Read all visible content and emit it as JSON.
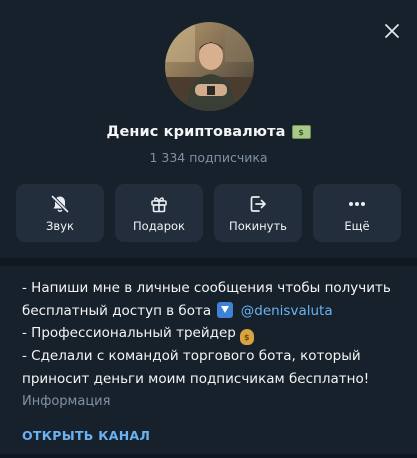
{
  "channel": {
    "title": "Денис криптовалюта",
    "title_emoji": "money-banknote-emoji",
    "subscribers": "1 334 подписчика"
  },
  "actions": [
    {
      "label": "Звук",
      "icon": "bell-muted-icon"
    },
    {
      "label": "Подарок",
      "icon": "gift-icon"
    },
    {
      "label": "Покинуть",
      "icon": "leave-icon"
    },
    {
      "label": "Ещё",
      "icon": "more-dots-icon"
    }
  ],
  "description": {
    "line1": "- Напиши мне в личные сообщения чтобы получить",
    "line2_text": "бесплатный доступ в бота",
    "line2_link": "@denisvaluta",
    "line3": "- Профессиональный трейдер",
    "line4": "- Сделали с командой торгового бота, который",
    "line5": "приносит деньги моим подписчикам бесплатно!",
    "caption": "Информация"
  },
  "open_channel_label": "ОТКРЫТЬ КАНАЛ",
  "colors": {
    "background": "#17212b",
    "button": "#232e3c",
    "accent": "#6ab2f2",
    "muted": "#7f91a4",
    "text": "#f5f5f5"
  }
}
